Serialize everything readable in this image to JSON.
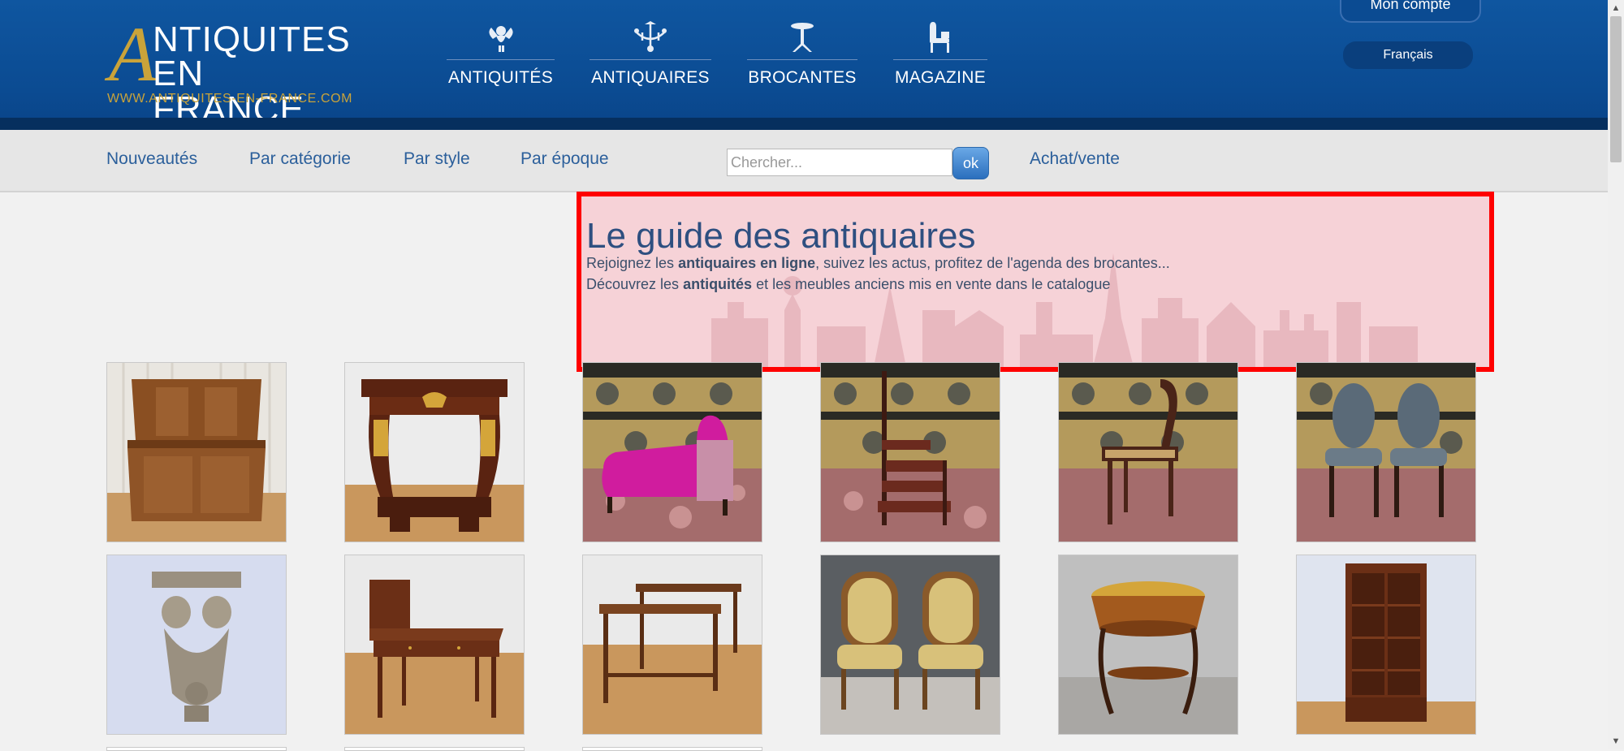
{
  "logo": {
    "letter": "A",
    "line1": "NTIQUITES",
    "line2": "EN FRANCE",
    "url": "WWW.ANTIQUITES-EN-FRANCE.COM"
  },
  "main_nav": [
    {
      "label": "ANTIQUITÉS",
      "icon": "cherub-icon"
    },
    {
      "label": "ANTIQUAIRES",
      "icon": "chandelier-icon"
    },
    {
      "label": "BROCANTES",
      "icon": "pedestal-table-icon"
    },
    {
      "label": "MAGAZINE",
      "icon": "chair-icon"
    }
  ],
  "account": {
    "label": "Mon compte"
  },
  "language": {
    "label": "Français"
  },
  "sub_nav": {
    "links": [
      "Nouveautés",
      "Par catégorie",
      "Par style",
      "Par époque"
    ],
    "search_placeholder": "Chercher...",
    "search_button": "ok",
    "buy_sell": "Achat/vente"
  },
  "banner": {
    "title": "Le guide des antiquaires",
    "line1_pre": "Rejoignez les ",
    "line1_bold": "antiquaires en ligne",
    "line1_post": ", suivez les actus, profitez de l'agenda des brocantes...",
    "line2_pre": "Découvrez les ",
    "line2_bold": "antiquités",
    "line2_post": " et les meubles anciens mis en vente dans le catalogue"
  },
  "products": [
    {
      "name": "product-walnut-buffet"
    },
    {
      "name": "product-empire-console"
    },
    {
      "name": "product-pink-chaise-longue"
    },
    {
      "name": "product-spiral-library-steps"
    },
    {
      "name": "product-cane-chair"
    },
    {
      "name": "product-pair-of-chairs"
    },
    {
      "name": "product-stone-cherub-sculpture"
    },
    {
      "name": "product-writing-desk"
    },
    {
      "name": "product-console-pair"
    },
    {
      "name": "product-pair-of-armchairs"
    },
    {
      "name": "product-marquetry-planter"
    },
    {
      "name": "product-glazed-bookcase"
    }
  ],
  "colors": {
    "header_blue": "#0b4b92",
    "gold": "#c9a33a",
    "link_blue": "#2b5f9b",
    "highlight_red": "#ff0000"
  }
}
